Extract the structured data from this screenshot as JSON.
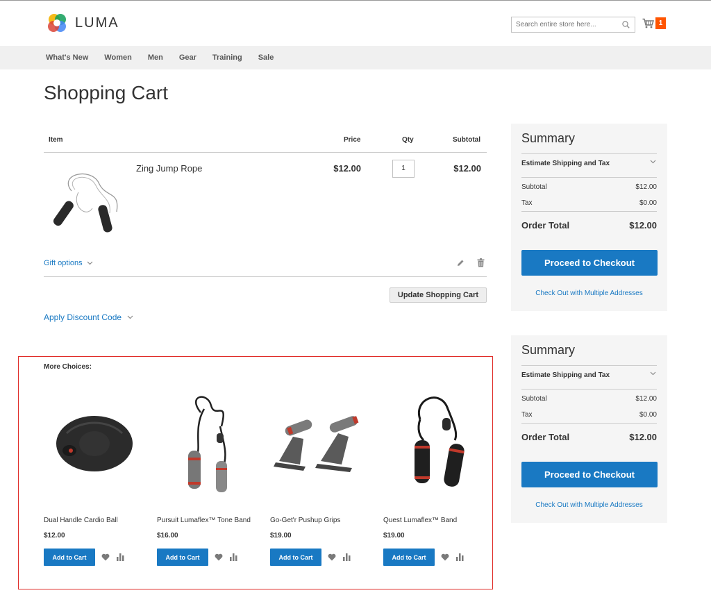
{
  "header": {
    "logo_text": "LUMA",
    "search_placeholder": "Search entire store here...",
    "cart_count": "1"
  },
  "nav": {
    "items": [
      "What's New",
      "Women",
      "Men",
      "Gear",
      "Training",
      "Sale"
    ]
  },
  "page_title": "Shopping Cart",
  "cart": {
    "columns": {
      "item": "Item",
      "price": "Price",
      "qty": "Qty",
      "subtotal": "Subtotal"
    },
    "item": {
      "name": "Zing Jump Rope",
      "price": "$12.00",
      "qty": "1",
      "subtotal": "$12.00"
    },
    "gift_options_label": "Gift options",
    "update_label": "Update Shopping Cart",
    "discount_label": "Apply Discount Code"
  },
  "summary": {
    "title": "Summary",
    "estimate_label": "Estimate Shipping and Tax",
    "subtotal_label": "Subtotal",
    "subtotal_value": "$12.00",
    "tax_label": "Tax",
    "tax_value": "$0.00",
    "order_total_label": "Order Total",
    "order_total_value": "$12.00",
    "checkout_label": "Proceed to Checkout",
    "multi_label": "Check Out with Multiple Addresses"
  },
  "more_choices": {
    "title": "More Choices:",
    "add_label": "Add to Cart",
    "products": [
      {
        "name": "Dual Handle Cardio Ball",
        "price": "$12.00"
      },
      {
        "name": "Pursuit Lumaflex™ Tone Band",
        "price": "$16.00"
      },
      {
        "name": "Go-Get'r Pushup Grips",
        "price": "$19.00"
      },
      {
        "name": "Quest Lumaflex™ Band",
        "price": "$19.00"
      }
    ]
  },
  "colors": {
    "accent": "#1979c3",
    "cart_badge": "#ff5501",
    "nav_bg": "#f0f0f0",
    "summary_bg": "#f5f5f5",
    "highlight_border": "#e02b27"
  }
}
